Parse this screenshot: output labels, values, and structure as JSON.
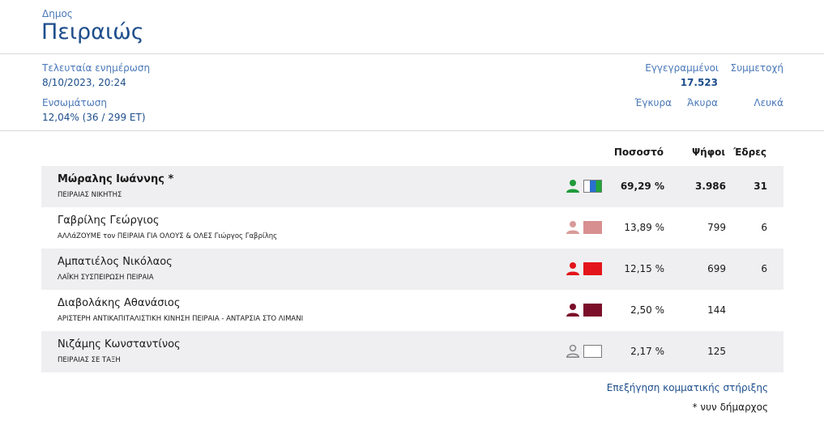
{
  "header": {
    "type": "Δημος",
    "name": "Πειραιώς"
  },
  "stats": {
    "last_update_label": "Τελευταία ενημέρωση",
    "last_update_value": "8/10/2023, 20:24",
    "integration_label": "Ενσωμάτωση",
    "integration_value": "12,04% (36 / 299 ΕΤ)",
    "registered_label": "Εγγεγραμμένοι",
    "registered_value": "17.523",
    "turnout_label": "Συμμετοχή",
    "valid_label": "Έγκυρα",
    "invalid_label": "Άκυρα",
    "blank_label": "Λευκά"
  },
  "columns": {
    "percent": "Ποσοστό",
    "votes": "Ψήφοι",
    "seats": "Έδρες"
  },
  "candidates": [
    {
      "name": "Μώραλης Ιωάννης *",
      "party": "ΠΕΙΡΑΙΑΣ ΝΙΚΗΤΗΣ",
      "percent": "69,29 %",
      "votes": "3.986",
      "seats": "31",
      "icon": "person-icon",
      "icon_color": "#1f9a3a",
      "party_colors": [
        "#ffffff",
        "#2a6fd1",
        "#23a33a"
      ]
    },
    {
      "name": "Γαβρίλης Γεώργιος",
      "party": "ΑΛΛάΖΟΥΜΕ τον ΠΕΙΡΑΙΑ ΓΙΑ ΟΛΟΥΣ & ΟΛΕΣ Γιώργος Γαβρίλης",
      "percent": "13,89 %",
      "votes": "799",
      "seats": "6",
      "icon": "person-icon",
      "icon_color": "#d99a9a",
      "party_colors": [
        "#d88f8f"
      ]
    },
    {
      "name": "Αμπατιέλος Νικόλαος",
      "party": "ΛΑΪΚΗ ΣΥΣΠΕΙΡΩΣΗ ΠΕΙΡΑΙΑ",
      "percent": "12,15 %",
      "votes": "699",
      "seats": "6",
      "icon": "person-icon",
      "icon_color": "#e3141b",
      "party_colors": [
        "#e3141b"
      ]
    },
    {
      "name": "Διαβολάκης Αθανάσιος",
      "party": "ΑΡΙΣΤΕΡΗ ΑΝΤΙΚΑΠΙΤΑΛΙΣΤΙΚΗ ΚΙΝΗΣΗ ΠΕΙΡΑΙΑ - ΑΝΤΑΡΣΙΑ ΣΤΟ ΛΙΜΑΝΙ",
      "percent": "2,50 %",
      "votes": "144",
      "seats": "",
      "icon": "person-icon",
      "icon_color": "#7b0f2a",
      "party_colors": [
        "#7b0f2a"
      ]
    },
    {
      "name": "Νιζάμης Κωνσταντίνος",
      "party": "ΠΕΙΡΑΙΑΣ ΣΕ ΤΑΞΗ",
      "percent": "2,17 %",
      "votes": "125",
      "seats": "",
      "icon": "person-outline-icon",
      "icon_color": "#8a8a8a",
      "party_colors": [
        "#ffffff"
      ]
    }
  ],
  "footer": {
    "support_link": "Επεξήγηση κομματικής στήριξης",
    "note": "* νυν δήμαρχος"
  }
}
